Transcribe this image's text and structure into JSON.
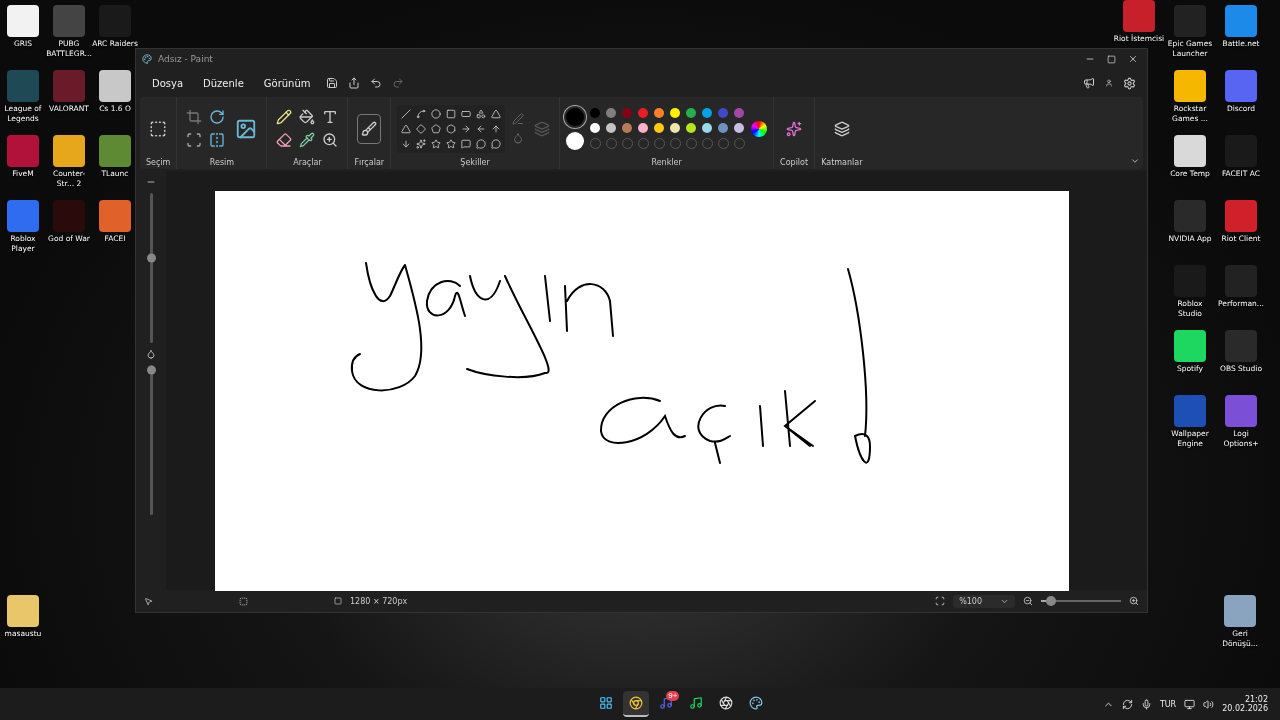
{
  "desktop_left": [
    [
      {
        "label": "GRIS",
        "color": "#f2f2f2"
      },
      {
        "label": "League of Legends",
        "color": "#1f4a55"
      },
      {
        "label": "FiveM",
        "color": "#b0123a"
      },
      {
        "label": "Roblox Player",
        "color": "#2f6cf0"
      }
    ],
    [
      {
        "label": "PUBG BATTLEGR...",
        "color": "#444444"
      },
      {
        "label": "VALORANT",
        "color": "#6a1b2a"
      },
      {
        "label": "Counter-Str... 2",
        "color": "#e6a81a"
      },
      {
        "label": "God of War",
        "color": "#2a0a0a"
      }
    ],
    [
      {
        "label": "ARC Raiders",
        "color": "#1a1a1a"
      },
      {
        "label": "Cs 1.6 O",
        "color": "#c8c8c8"
      },
      {
        "label": "TLaunc",
        "color": "#5d8a33"
      },
      {
        "label": "FACEI",
        "color": "#e0622a"
      }
    ]
  ],
  "desktop_left_bottom": {
    "label": "masaustu",
    "color": "#e8c66a"
  },
  "desktop_right": [
    [
      {
        "label": "Riot İstemcisi",
        "color": "#c8202a"
      }
    ],
    [
      {
        "label": "Epic Games Launcher",
        "color": "#222222"
      },
      {
        "label": "Rockstar Games ...",
        "color": "#f5b700"
      },
      {
        "label": "Core Temp",
        "color": "#d9d9d9"
      },
      {
        "label": "NVIDIA App",
        "color": "#2a2a2a"
      },
      {
        "label": "Roblox Studio",
        "color": "#1a1a1a"
      },
      {
        "label": "Spotify",
        "color": "#1ed760"
      },
      {
        "label": "Wallpaper Engine",
        "color": "#1e4fb5"
      }
    ],
    [
      {
        "label": "Battle.net",
        "color": "#1c8ae8"
      },
      {
        "label": "Discord",
        "color": "#5865f2"
      },
      {
        "label": "FACEIT AC",
        "color": "#1a1a1a"
      },
      {
        "label": "Riot Client",
        "color": "#d0202a"
      },
      {
        "label": "Performan...",
        "color": "#222222"
      },
      {
        "label": "OBS Studio",
        "color": "#2a2a2a"
      },
      {
        "label": "Logi Options+",
        "color": "#7b4fd6"
      }
    ]
  ],
  "desktop_right_bottom": {
    "label": "Geri Dönüşü...",
    "color": "#8aa4c0"
  },
  "paint": {
    "title": "Adsız - Paint",
    "menu": [
      "Dosya",
      "Düzenle",
      "Görünüm"
    ],
    "groups": [
      "Seçim",
      "Resim",
      "Araçlar",
      "Fırçalar",
      "Şekiller",
      "Renkler",
      "Copilot",
      "Katmanlar"
    ],
    "primary": {
      "color": "#000000"
    },
    "secondary": {
      "color": "#ffffff"
    },
    "palette": [
      [
        {
          "color": "#000000"
        },
        {
          "color": "#7f7f7f"
        },
        {
          "color": "#880015"
        },
        {
          "color": "#ed1c24"
        },
        {
          "color": "#ff7f27"
        },
        {
          "color": "#fff200"
        },
        {
          "color": "#22b14c"
        },
        {
          "color": "#00a2e8"
        },
        {
          "color": "#3f48cc"
        },
        {
          "color": "#a349a4"
        }
      ],
      [
        {
          "color": "#ffffff"
        },
        {
          "color": "#c3c3c3"
        },
        {
          "color": "#b97a57"
        },
        {
          "color": "#ffaec9"
        },
        {
          "color": "#ffc90e"
        },
        {
          "color": "#efe4b0"
        },
        {
          "color": "#b5e61d"
        },
        {
          "color": "#99d9ea"
        },
        {
          "color": "#7092be"
        },
        {
          "color": "#c8bfe7"
        }
      ]
    ],
    "size_slider": {
      "level": 0.57
    },
    "opacity_slider": {
      "level": 0.97
    },
    "status": {
      "canvas_size": "1280 × 720px",
      "zoom": "%100",
      "zoom_slider": {
        "level": 0.12
      }
    }
  },
  "taskbar": {
    "apps": [
      {
        "kind": "start",
        "selected": false
      },
      {
        "kind": "chrome",
        "selected": true
      },
      {
        "kind": "discord",
        "selected": false,
        "badge": "9+"
      },
      {
        "kind": "spotify",
        "selected": false
      },
      {
        "kind": "obs",
        "selected": false
      },
      {
        "kind": "paint",
        "selected": false
      }
    ],
    "language": "TUR",
    "time": "21:02",
    "date": "20.02.2026"
  }
}
